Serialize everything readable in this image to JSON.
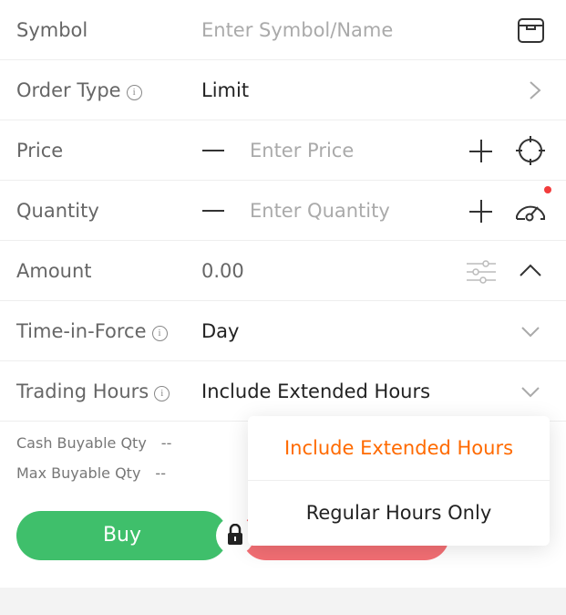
{
  "symbol": {
    "label": "Symbol",
    "placeholder": "Enter Symbol/Name",
    "icon": "box-icon"
  },
  "order_type": {
    "label": "Order Type",
    "value": "Limit"
  },
  "price": {
    "label": "Price",
    "placeholder": "Enter Price"
  },
  "quantity": {
    "label": "Quantity",
    "placeholder": "Enter Quantity"
  },
  "amount": {
    "label": "Amount",
    "value": "0.00"
  },
  "time_in_force": {
    "label": "Time-in-Force",
    "value": "Day"
  },
  "trading_hours": {
    "label": "Trading Hours",
    "value": "Include Extended Hours"
  },
  "info": {
    "cash_label": "Cash Buyable Qty",
    "cash_value": "--",
    "max_label": "Max Buyable Qty",
    "max_value": "--"
  },
  "buttons": {
    "buy": "Buy"
  },
  "colors": {
    "buy": "#3fbf6b",
    "sell": "#f36f74",
    "accent": "#ff6a00"
  },
  "dropdown": {
    "options": [
      {
        "label": "Include Extended Hours",
        "selected": true
      },
      {
        "label": "Regular Hours Only",
        "selected": false
      }
    ]
  }
}
